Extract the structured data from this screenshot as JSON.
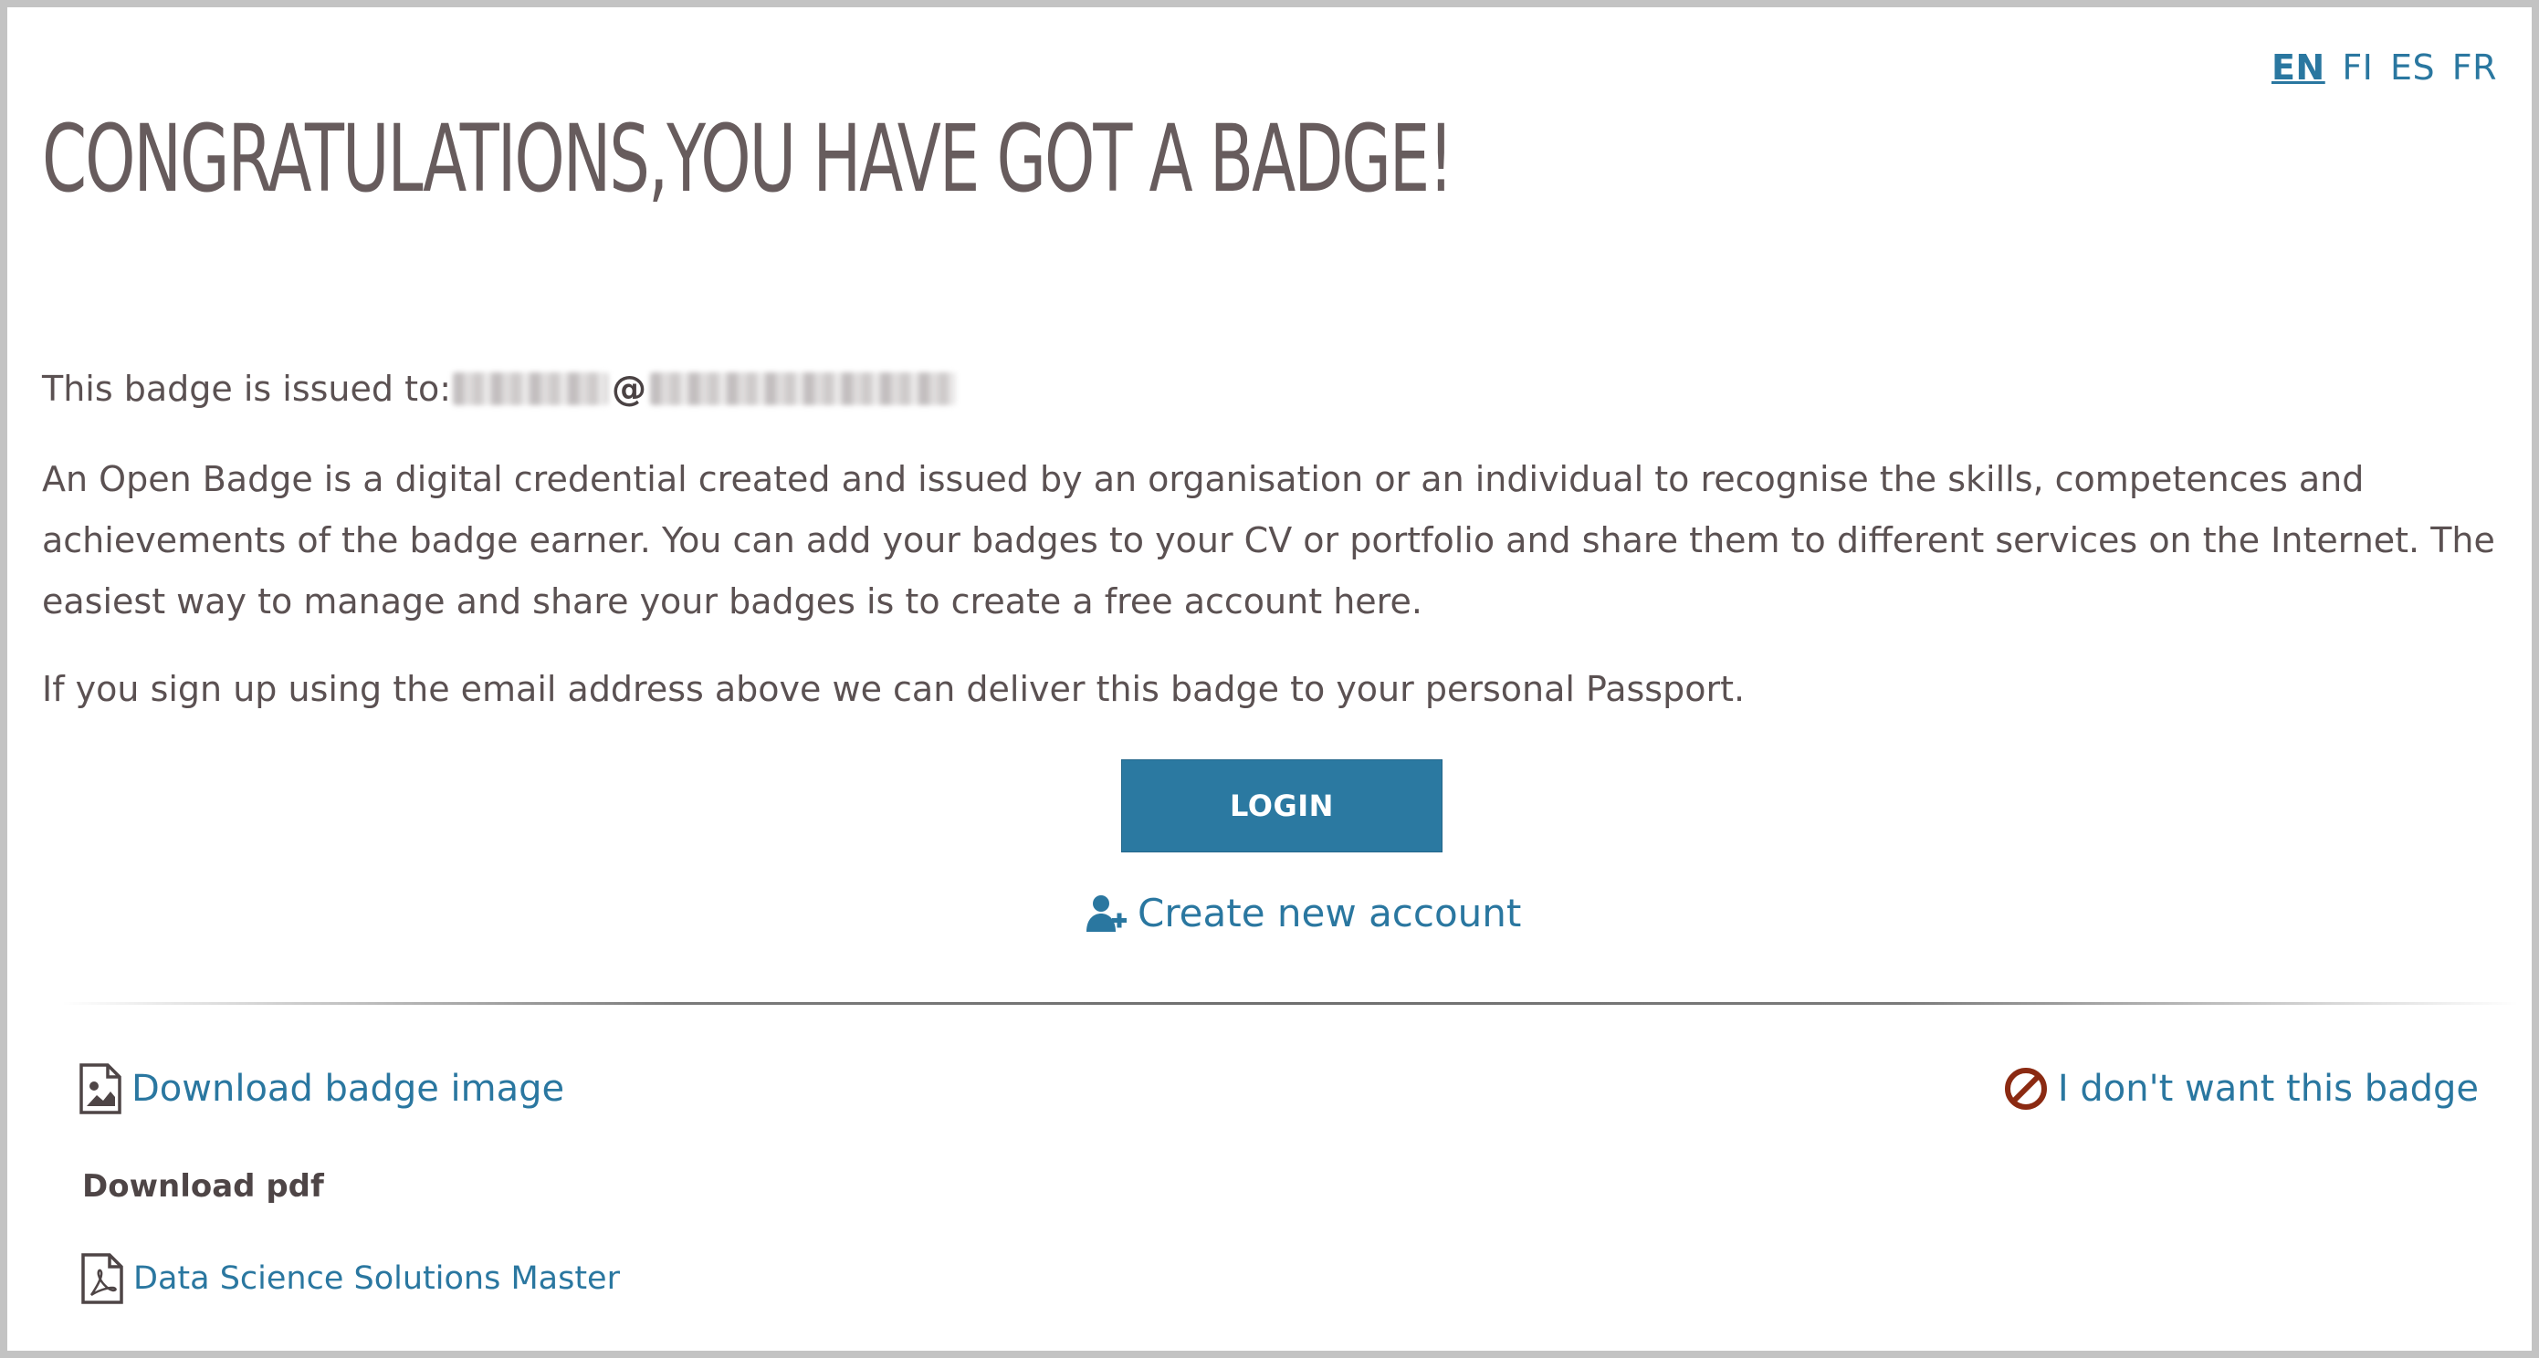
{
  "languages": [
    {
      "code": "EN",
      "active": true
    },
    {
      "code": "FI",
      "active": false
    },
    {
      "code": "ES",
      "active": false
    },
    {
      "code": "FR",
      "active": false
    }
  ],
  "page": {
    "title": "CONGRATULATIONS,YOU HAVE GOT A BADGE!",
    "issued_label": "This badge is issued to:",
    "email_at": "@",
    "description": "An Open Badge is a digital credential created and issued by an organisation or an individual to recognise the skills, competences and achievements of the badge earner. You can add your badges to your CV or portfolio and share them to different services on the Internet. The easiest way to manage and share your badges is to create a free account here.",
    "signup_note": "If you sign up using the email address above we can deliver this badge to your personal Passport."
  },
  "actions": {
    "login_label": "LOGIN",
    "create_account_label": "Create new account",
    "download_image_label": "Download badge image",
    "decline_label": "I don't want this badge",
    "pdf_heading": "Download pdf",
    "pdf_item_label": "Data Science Solutions Master"
  },
  "colors": {
    "link": "#2a77a0",
    "button": "#2b79a1",
    "text": "#5b5152",
    "decline_icon": "#8b2a12"
  },
  "icons": {
    "create_account": "user-plus-icon",
    "download_image": "file-image-icon",
    "decline": "ban-icon",
    "pdf": "file-pdf-icon"
  }
}
